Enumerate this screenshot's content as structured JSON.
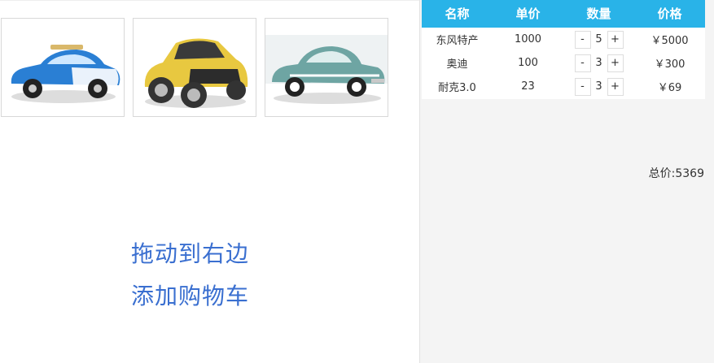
{
  "products": [
    {
      "name": "blue-classic-car-image",
      "colors": {
        "body": "#2a7fd4",
        "accent": "#ffffff"
      }
    },
    {
      "name": "yellow-cartoon-car-image",
      "colors": {
        "body": "#e8c840",
        "accent": "#333333"
      }
    },
    {
      "name": "teal-vintage-car-image",
      "colors": {
        "body": "#6ea5a3",
        "accent": "#ffffff"
      }
    }
  ],
  "hint": {
    "line1": "拖动到右边",
    "line2": "添加购物车"
  },
  "cart": {
    "headers": {
      "name": "名称",
      "price": "单价",
      "qty": "数量",
      "subtotal": "价格"
    },
    "rows": [
      {
        "name": "东风特产",
        "price": "1000",
        "qty": "5",
        "minus": "-",
        "plus": "+",
        "subtotal": "￥5000"
      },
      {
        "name": "奥迪",
        "price": "100",
        "qty": "3",
        "minus": "-",
        "plus": "+",
        "subtotal": "￥300"
      },
      {
        "name": "耐克3.0",
        "price": "23",
        "qty": "3",
        "minus": "-",
        "plus": "+",
        "subtotal": "￥69"
      }
    ],
    "total_label": "总价:5369"
  },
  "colors": {
    "header_bg": "#29b3e8",
    "hint_text": "#3a6fd0",
    "panel_bg": "#f4f4f4"
  }
}
